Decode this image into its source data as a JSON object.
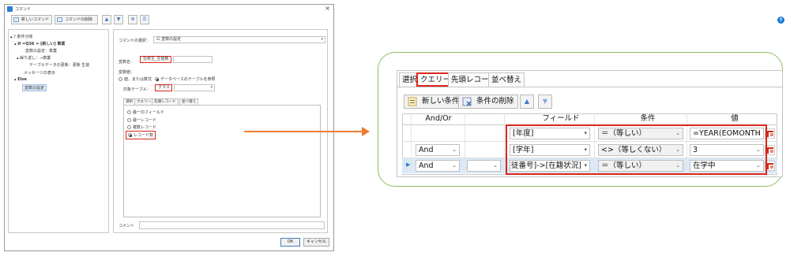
{
  "dialog": {
    "title": "コマンド",
    "close": "×",
    "toolbar": {
      "new_command": "新しいコマンド",
      "delete_command": "コマンドの削除",
      "up": "▲",
      "down": "▼",
      "view1": "≣",
      "view2": "☰",
      "help": "?"
    },
    "tree": [
      {
        "text": "▴ ? 条件分岐"
      },
      {
        "text": "▴ If  =Q36 = [新しい] 章業"
      },
      {
        "text": "変数の設定：章業"
      },
      {
        "text": "▴ 繰り返し：→章業"
      },
      {
        "text": "テーブルデータの更新：更新 生徒"
      },
      {
        "text": "メッセージの表示"
      },
      {
        "text": "▴ Else"
      },
      {
        "text": "変数の設定"
      }
    ],
    "panel": {
      "command_select_label": "コマンドの選択：",
      "command_select_value": "☷ 変数の設定",
      "var_name_label": "変数名：",
      "var_name_value": "在校生_生徒数",
      "var_value_label": "変数値：",
      "radio_value_expr": "値、または数式",
      "radio_db_ref": "データベースのテーブルを参照",
      "target_table_label": "対象テーブル：",
      "target_table_value": "クラス",
      "tabs": [
        "選択",
        "クエリー",
        "先頭レコード",
        "並べ替え"
      ],
      "options": [
        "最一のフィールド",
        "最一レコード",
        "複数レコード",
        "レコード数"
      ],
      "comment_label": "コメント"
    },
    "ok": "OK",
    "cancel": "キャンセル"
  },
  "zoom": {
    "tabs": [
      "選択",
      "クエリー",
      "先頭レコード",
      "並べ替え"
    ],
    "new_condition": "新しい条件",
    "delete_condition": "条件の削除",
    "up": "▲",
    "down": "▼",
    "headers": {
      "andor": "And/Or",
      "field": "フィールド",
      "condition": "条件",
      "value": "値"
    },
    "rows": [
      {
        "andor": "",
        "field": "[年度]",
        "cond": "＝（等しい）",
        "value": "=YEAR(EOMONTH"
      },
      {
        "andor": "And",
        "field": "[学年]",
        "cond": "<>（等しくない）",
        "value": "3"
      },
      {
        "andor": "And",
        "field": "[生徒番号]->[在籍状況]",
        "cond": "＝（等しい）",
        "value": "在学中"
      }
    ]
  },
  "colors": {
    "highlight": "#d9261c",
    "arrow": "#ed7d31",
    "callout": "#8cbf5c"
  }
}
